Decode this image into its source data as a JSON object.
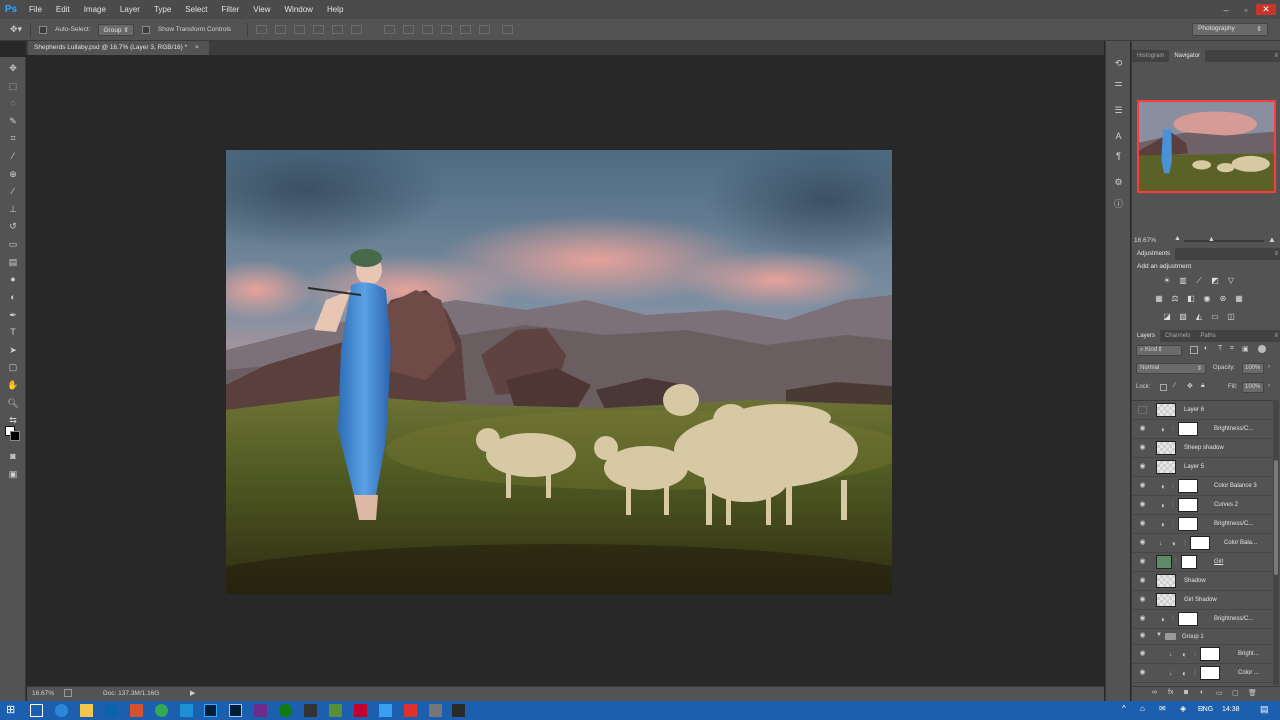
{
  "app": {
    "logo": "Ps"
  },
  "menu": [
    "File",
    "Edit",
    "Image",
    "Layer",
    "Type",
    "Select",
    "Filter",
    "View",
    "Window",
    "Help"
  ],
  "window_controls": [
    "–",
    "▫",
    "✕"
  ],
  "options": {
    "auto_select_label": "Auto-Select:",
    "auto_select_value": "Group",
    "show_transform_label": "Show Transform Controls",
    "workspace": "Photography"
  },
  "document": {
    "tab_title": "Shepherds Lullaby.psd @ 16.7% (Layer 3, RGB/16) *",
    "tab_close": "×"
  },
  "status": {
    "zoom": "16.67%",
    "doc": "Doc: 137.3M/1.16G"
  },
  "navigator": {
    "tabs": [
      "Histogram",
      "Navigator"
    ],
    "active_tab": "Navigator",
    "zoom": "16.67%"
  },
  "adjustments": {
    "tab": "Adjustments",
    "title": "Add an adjustment"
  },
  "layers_panel": {
    "tabs": [
      "Layers",
      "Channels",
      "Paths"
    ],
    "filter_kind": "Kind",
    "blend_mode": "Normal",
    "opacity_label": "Opacity:",
    "opacity_value": "100%",
    "lock_label": "Lock:",
    "fill_label": "Fill:",
    "fill_value": "100%",
    "layers": [
      {
        "name": "Layer 6",
        "visible": false
      },
      {
        "name": "Brightness/C...",
        "visible": true
      },
      {
        "name": "Sheep shadow",
        "visible": true
      },
      {
        "name": "Layer 5",
        "visible": true
      },
      {
        "name": "Color Balance 3",
        "visible": true
      },
      {
        "name": "Curves 2",
        "visible": true
      },
      {
        "name": "Brightness/C...",
        "visible": true
      },
      {
        "name": "Color Bala...",
        "visible": true
      },
      {
        "name": "Girl",
        "visible": true
      },
      {
        "name": "Shadow",
        "visible": true
      },
      {
        "name": "Girl Shadow",
        "visible": true
      },
      {
        "name": "Brightness/C...",
        "visible": true
      },
      {
        "name": "Group 1",
        "visible": true
      },
      {
        "name": "Bright...",
        "visible": true
      },
      {
        "name": "Color ...",
        "visible": true
      }
    ]
  },
  "taskbar": {
    "language": "ENG",
    "time": "14:38"
  },
  "colors": {
    "menubar": "#4b4b4b",
    "panel": "#535353",
    "canvas_bg": "#282828",
    "taskbar": "#1b5fae",
    "nav_frame": "#ff3b3b"
  }
}
